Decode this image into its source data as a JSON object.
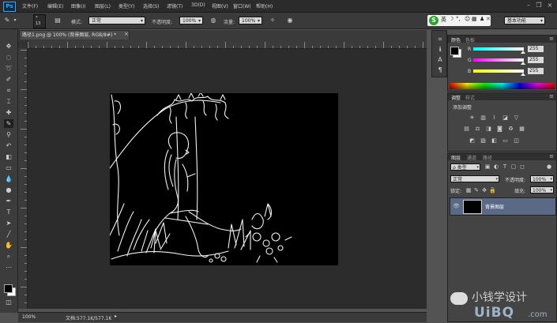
{
  "app": {
    "logo": "Ps"
  },
  "menubar": {
    "items": [
      "文件(F)",
      "编辑(E)",
      "图像(I)",
      "图层(L)",
      "类型(Y)",
      "选择(S)",
      "滤镜(T)",
      "3D(D)",
      "视图(V)",
      "窗口(W)",
      "帮助(H)"
    ]
  },
  "options": {
    "brush_size": "13",
    "mode_label": "模式:",
    "mode_value": "正常",
    "opacity_label": "不透明度:",
    "opacity_value": "100%",
    "flow_label": "流量:",
    "flow_value": "100%",
    "workspace": "基本功能"
  },
  "ime": {
    "letter": "S",
    "mode": "英"
  },
  "document": {
    "tab_title": "路径1.png @ 100% (背景图层, RGB/8#) *",
    "close_glyph": "×",
    "zoom": "100%",
    "doc_size": "文档:577.1K/577.1K"
  },
  "color_panel": {
    "tabs": [
      "颜色",
      "色板"
    ],
    "r_label": "R",
    "g_label": "G",
    "b_label": "B",
    "r_value": "255",
    "g_value": "255",
    "b_value": "255"
  },
  "adjustments_panel": {
    "tabs": [
      "调整",
      "样式"
    ],
    "title": "添加调整"
  },
  "layers_panel": {
    "tabs": [
      "图层",
      "通道",
      "路径"
    ],
    "filter_kind": "ρ 类型",
    "blend_mode": "正常",
    "opacity_label": "不透明度:",
    "opacity_value": "100%",
    "lock_label": "锁定:",
    "fill_label": "填充:",
    "fill_value": "100%",
    "layers": [
      {
        "name": "背景图层"
      }
    ]
  },
  "watermark": {
    "author": "小钱学设计",
    "site": "UiBQ",
    "site_suffix": ".com"
  }
}
